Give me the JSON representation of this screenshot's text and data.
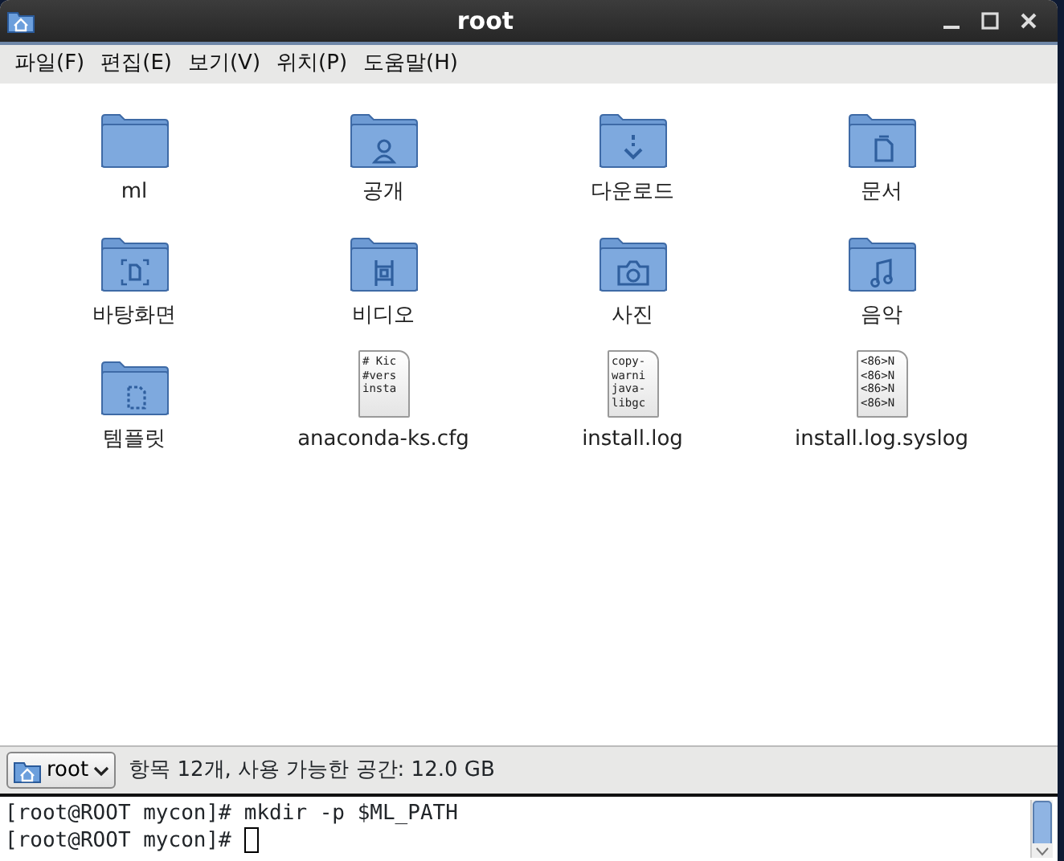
{
  "window": {
    "title": "root"
  },
  "menu": [
    "파일(F)",
    "편집(E)",
    "보기(V)",
    "위치(P)",
    "도움말(H)"
  ],
  "items": [
    {
      "name": "ml",
      "kind": "folder"
    },
    {
      "name": "공개",
      "kind": "public"
    },
    {
      "name": "다운로드",
      "kind": "downloads"
    },
    {
      "name": "문서",
      "kind": "documents"
    },
    {
      "name": "바탕화면",
      "kind": "desktop"
    },
    {
      "name": "비디오",
      "kind": "videos"
    },
    {
      "name": "사진",
      "kind": "pictures"
    },
    {
      "name": "음악",
      "kind": "music"
    },
    {
      "name": "템플릿",
      "kind": "templates"
    },
    {
      "name": "anaconda-ks.cfg",
      "kind": "text",
      "preview": [
        "# Kic",
        "#vers",
        "insta"
      ]
    },
    {
      "name": "install.log",
      "kind": "text",
      "preview": [
        "copy-",
        "warni",
        "java-",
        "libgc"
      ]
    },
    {
      "name": "install.log.syslog",
      "kind": "text",
      "preview": [
        "<86>N",
        "<86>N",
        "<86>N",
        "<86>N"
      ]
    }
  ],
  "status_bar": {
    "location": "root",
    "info": "항목 12개, 사용 가능한 공간: 12.0 GB"
  },
  "terminal": {
    "lines": [
      {
        "prompt": "[root@ROOT mycon]#",
        "command": "mkdir -p $ML_PATH",
        "cursor": false
      },
      {
        "prompt": "[root@ROOT mycon]#",
        "cursor": true
      }
    ]
  }
}
